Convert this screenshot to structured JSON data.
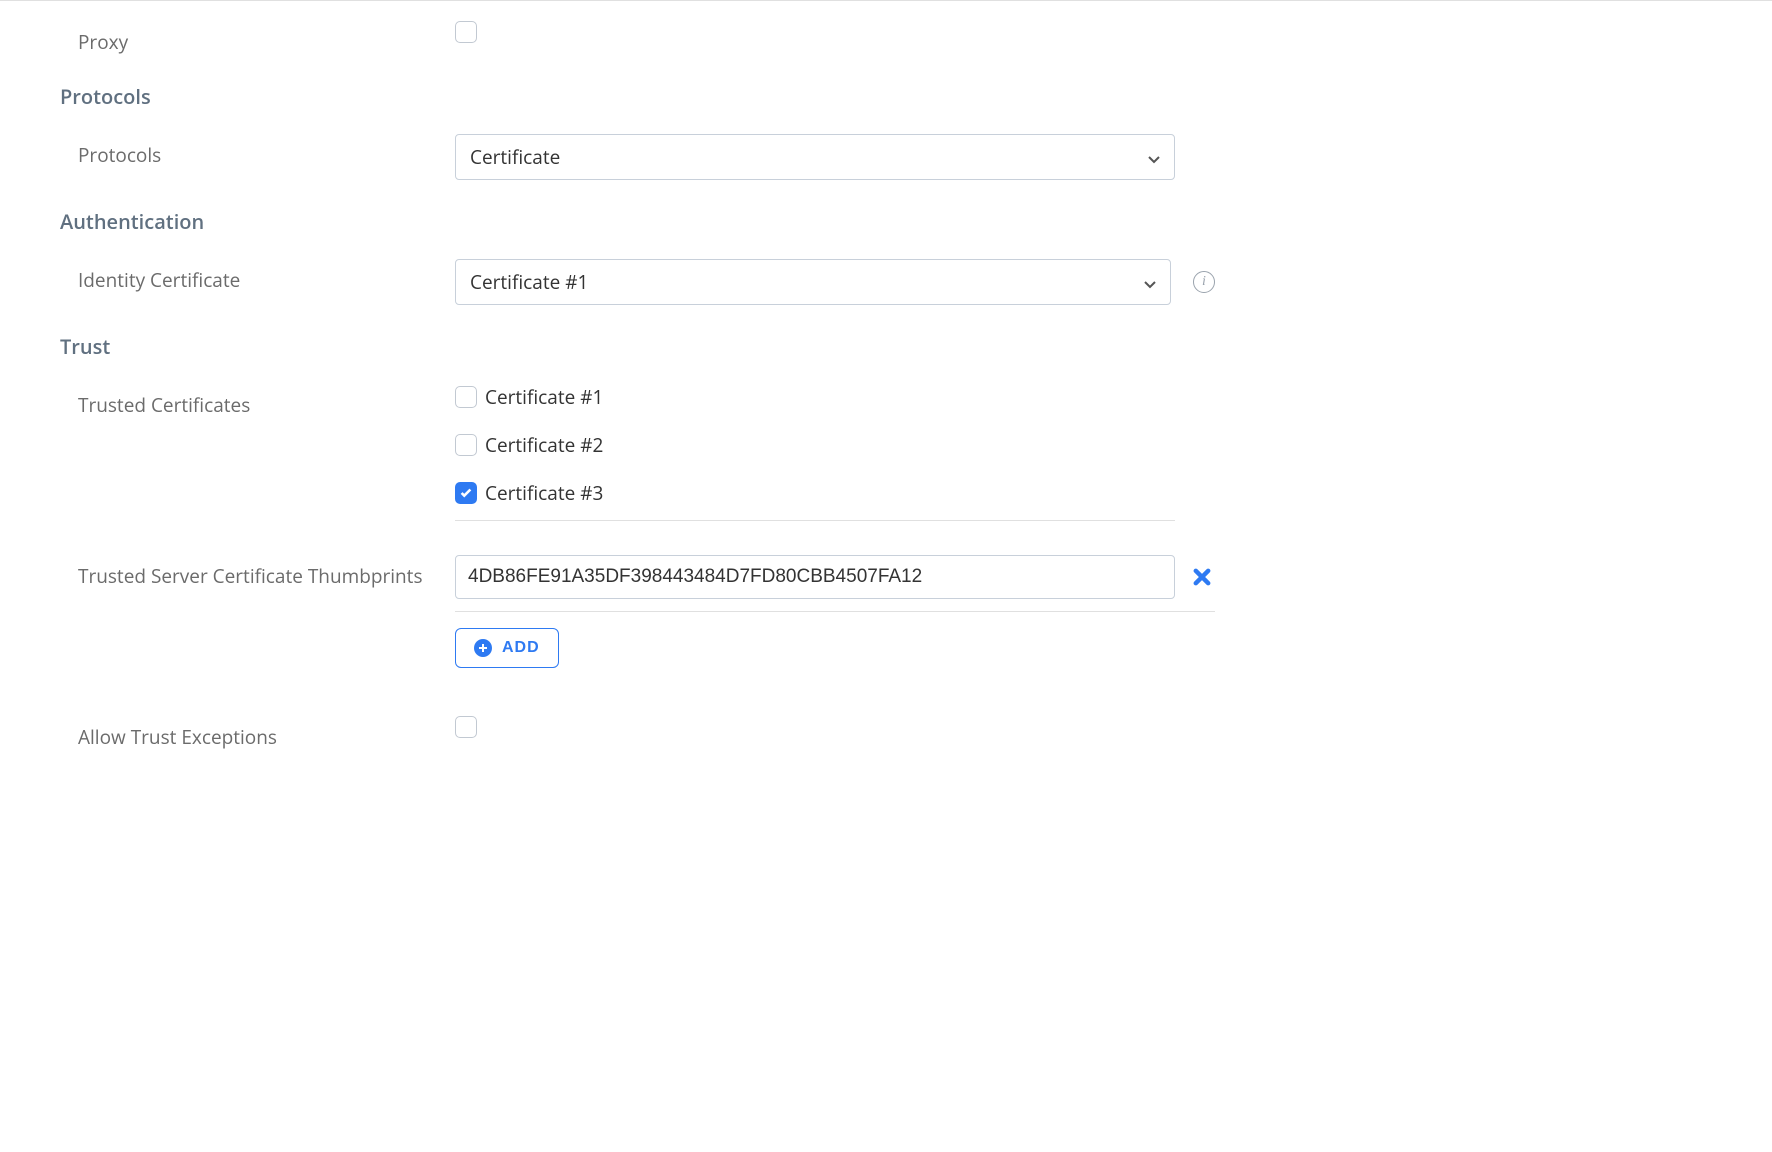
{
  "proxy": {
    "label": "Proxy",
    "checked": false
  },
  "sections": {
    "protocols_heading": "Protocols",
    "authentication_heading": "Authentication",
    "trust_heading": "Trust"
  },
  "protocols": {
    "label": "Protocols",
    "selected": "Certificate"
  },
  "identity_certificate": {
    "label": "Identity Certificate",
    "selected": "Certificate #1"
  },
  "trusted_certificates": {
    "label": "Trusted Certificates",
    "items": [
      {
        "label": "Certificate #1",
        "checked": false
      },
      {
        "label": "Certificate #2",
        "checked": false
      },
      {
        "label": "Certificate #3",
        "checked": true
      }
    ]
  },
  "thumbprints": {
    "label": "Trusted Server Certificate Thumbprints",
    "values": [
      "4DB86FE91A35DF398443484D7FD80CBB4507FA12"
    ],
    "add_label": "ADD"
  },
  "allow_trust_exceptions": {
    "label": "Allow Trust Exceptions",
    "checked": false
  }
}
